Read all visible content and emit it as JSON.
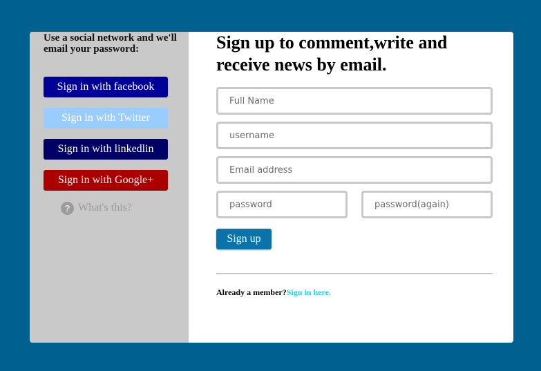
{
  "sidebar": {
    "title": "Use a social network and we'll email your password:",
    "buttons": [
      {
        "label": "Sign in with facebook",
        "color": "#000099"
      },
      {
        "label": "Sign in with Twitter",
        "color": "#99ccff"
      },
      {
        "label": "Sign in with linkedlin",
        "color": "#000066"
      },
      {
        "label": "Sign in with Google+",
        "color": "#aa0000"
      }
    ],
    "whats_this": {
      "icon": "question-icon",
      "glyph": "?",
      "label": "What's this?"
    }
  },
  "main": {
    "title": "Sign up to comment,write and receive news by email.",
    "full_name_placeholder": "Full Name",
    "username_placeholder": "username",
    "email_placeholder": "Email address",
    "password_placeholder": "password",
    "password_again_placeholder": "password(again)",
    "signup_label": "Sign up",
    "member_text": "Already a member?",
    "member_link": "Sign in here."
  },
  "colors": {
    "background": "#006090",
    "sidebar": "#c9c9c9",
    "primary_button": "#0b72aa",
    "link": "#1fd3ea"
  }
}
